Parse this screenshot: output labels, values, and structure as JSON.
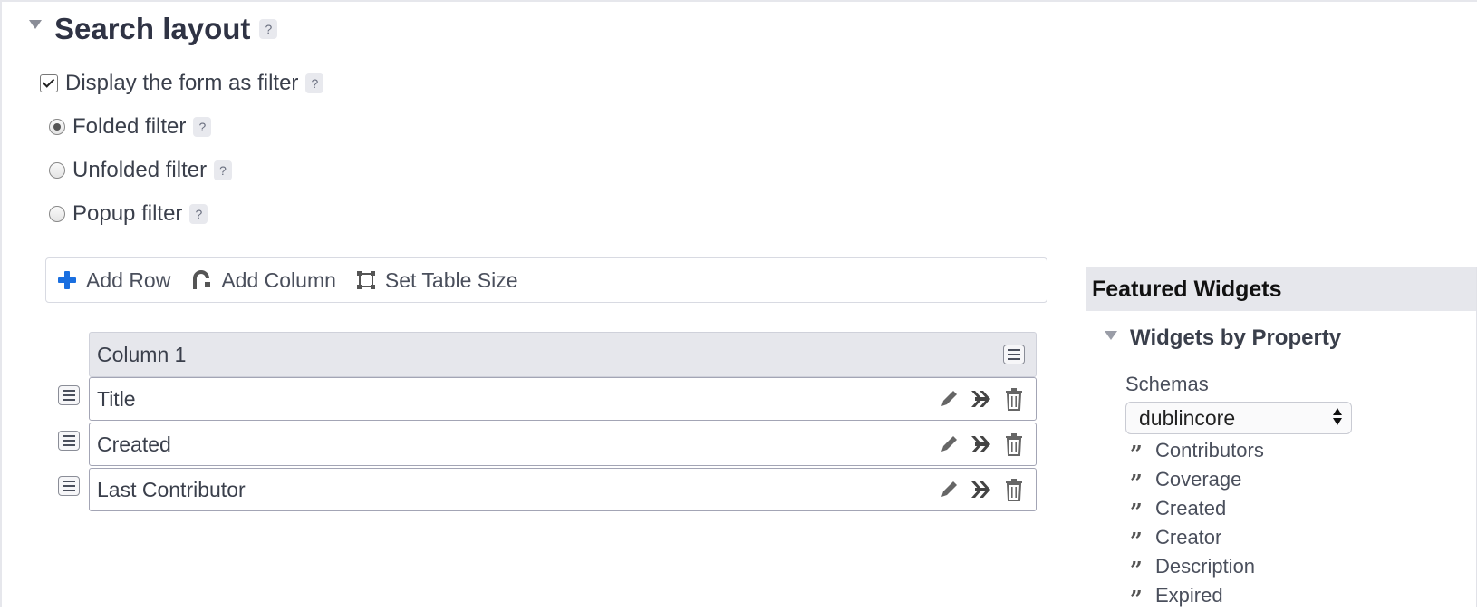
{
  "section": {
    "title": "Search layout",
    "help": "?"
  },
  "display_filter": {
    "label": "Display the form as filter",
    "checked": true,
    "help": "?"
  },
  "filter_modes": [
    {
      "label": "Folded filter",
      "checked": true,
      "help": "?"
    },
    {
      "label": "Unfolded filter",
      "checked": false,
      "help": "?"
    },
    {
      "label": "Popup filter",
      "checked": false,
      "help": "?"
    }
  ],
  "toolbar": {
    "add_row": "Add Row",
    "add_column": "Add Column",
    "set_table_size": "Set Table Size"
  },
  "table": {
    "column_header": "Column 1",
    "rows": [
      "Title",
      "Created",
      "Last Contributor"
    ]
  },
  "featured": {
    "title": "Featured Widgets",
    "section_title": "Widgets by Property",
    "schemas_label": "Schemas",
    "schema_value": "dublincore",
    "properties": [
      "Contributors",
      "Coverage",
      "Created",
      "Creator",
      "Description",
      "Expired"
    ]
  },
  "colors": {
    "accent_blue": "#1a6fe0",
    "text": "#3a3f4b",
    "header_bg": "#e6e7ec"
  }
}
